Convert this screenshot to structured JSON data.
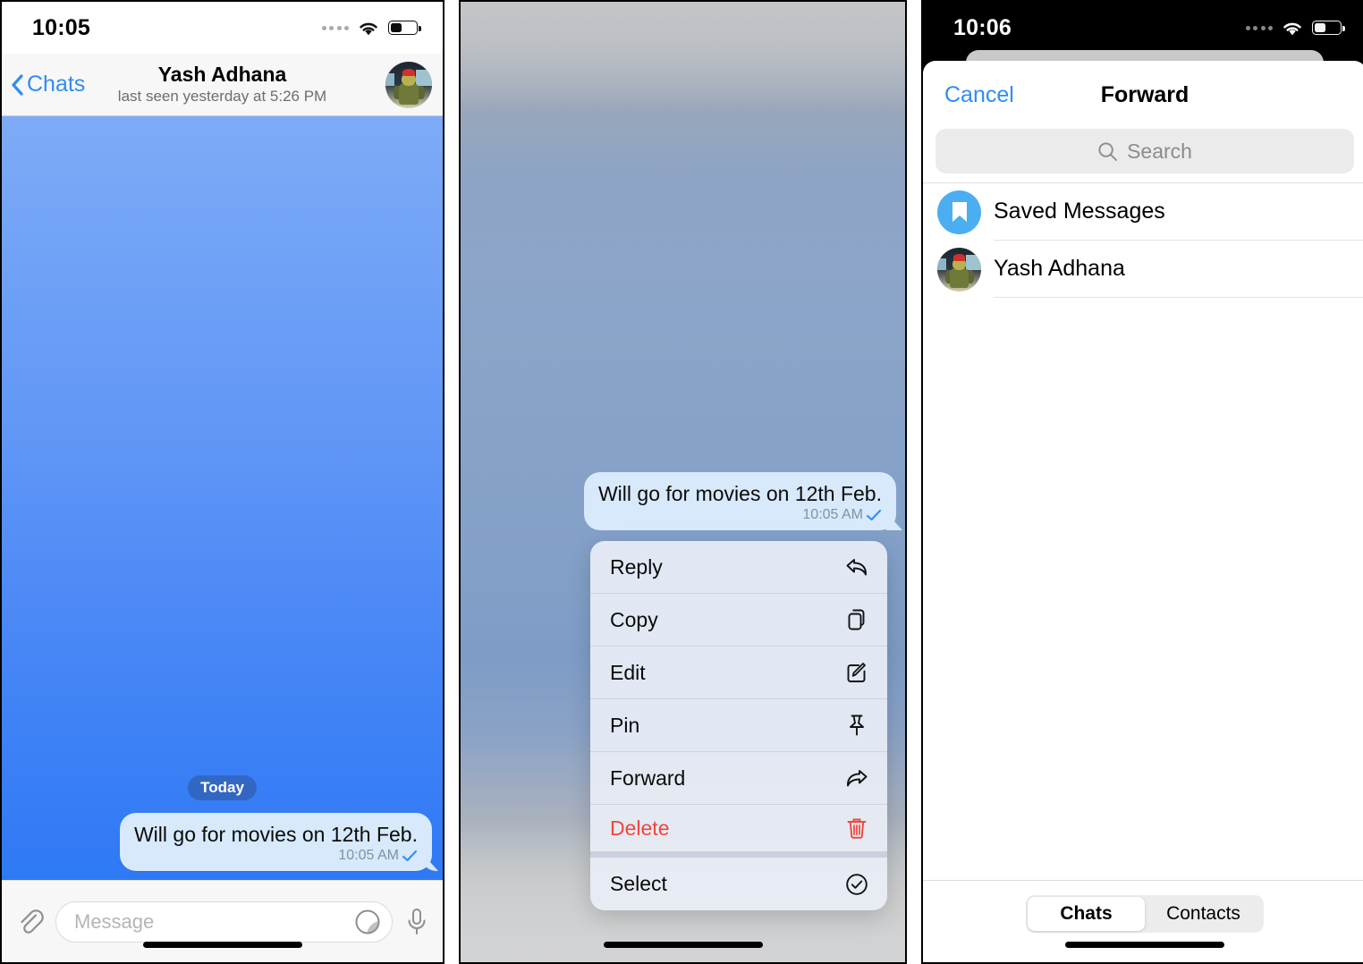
{
  "panel1": {
    "status": {
      "time": "10:05",
      "wifi_icon": "wifi-icon",
      "battery_icon": "battery-icon",
      "signal_icon": "signal-dots-icon"
    },
    "header": {
      "back_label": "Chats",
      "back_icon": "chevron-left-icon",
      "title": "Yash Adhana",
      "subtitle": "last seen yesterday at 5:26 PM",
      "avatar_name": "yash-adhana-avatar"
    },
    "chat": {
      "day_chip": "Today",
      "message": {
        "text": "Will go for movies on 12th Feb.",
        "time": "10:05 AM",
        "status_icon": "single-check-icon"
      }
    },
    "input": {
      "attach_icon": "paperclip-icon",
      "placeholder": "Message",
      "sticker_icon": "sticker-icon",
      "mic_icon": "microphone-icon"
    }
  },
  "panel2": {
    "message": {
      "text": "Will go for movies on 12th Feb.",
      "time": "10:05 AM",
      "status_icon": "single-check-icon"
    },
    "context_menu": [
      {
        "label": "Reply",
        "icon": "reply-arrow-icon",
        "danger": false
      },
      {
        "label": "Copy",
        "icon": "copy-icon",
        "danger": false
      },
      {
        "label": "Edit",
        "icon": "edit-pencil-icon",
        "danger": false
      },
      {
        "label": "Pin",
        "icon": "pin-icon",
        "danger": false
      },
      {
        "label": "Forward",
        "icon": "forward-arrow-icon",
        "danger": false
      },
      {
        "label": "Delete",
        "icon": "trash-icon",
        "danger": true
      },
      {
        "label": "Select",
        "icon": "check-circle-icon",
        "danger": false
      }
    ],
    "colors": {
      "delete_red": "#F2453D",
      "bubble": "#D7E9FB",
      "menu_bg": "#E9EEF6"
    }
  },
  "panel3": {
    "status": {
      "time": "10:06",
      "wifi_icon": "wifi-icon",
      "battery_icon": "battery-icon",
      "signal_icon": "signal-dots-icon"
    },
    "sheet": {
      "cancel_label": "Cancel",
      "title": "Forward",
      "search": {
        "placeholder": "Search",
        "icon": "search-icon"
      },
      "rows": [
        {
          "label": "Saved Messages",
          "avatar": "saved-messages-bookmark-icon"
        },
        {
          "label": "Yash Adhana",
          "avatar": "yash-adhana-avatar"
        }
      ],
      "tabs": [
        {
          "label": "Chats",
          "active": true
        },
        {
          "label": "Contacts",
          "active": false
        }
      ]
    },
    "colors": {
      "accent_blue": "#2F8CF7",
      "saved_blue": "#4BAEF0"
    }
  }
}
